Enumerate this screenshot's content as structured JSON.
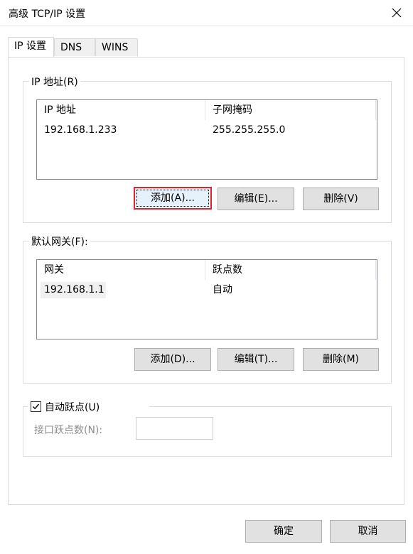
{
  "window": {
    "title": "高级 TCP/IP 设置"
  },
  "tabs": [
    {
      "label": "IP 设置",
      "active": true
    },
    {
      "label": "DNS",
      "active": false
    },
    {
      "label": "WINS",
      "active": false
    }
  ],
  "ip_section": {
    "legend": "IP 地址(R)",
    "columns": [
      "IP 地址",
      "子网掩码"
    ],
    "rows": [
      {
        "ip": "192.168.1.233",
        "mask": "255.255.255.0"
      }
    ],
    "buttons": {
      "add": "添加(A)...",
      "edit": "编辑(E)...",
      "delete": "删除(V)"
    }
  },
  "gateway_section": {
    "legend": "默认网关(F):",
    "columns": [
      "网关",
      "跃点数"
    ],
    "rows": [
      {
        "gateway": "192.168.1.1",
        "metric": "自动"
      }
    ],
    "buttons": {
      "add": "添加(D)...",
      "edit": "编辑(T)...",
      "delete": "删除(M)"
    }
  },
  "auto_metric": {
    "label": "自动跃点(U)",
    "checked": true,
    "interface_metric_label": "接口跃点数(N):",
    "interface_metric_value": ""
  },
  "footer": {
    "ok": "确定",
    "cancel": "取消"
  },
  "colors": {
    "focus_highlight": "#d9272f",
    "button_face": "#e1e1e1"
  }
}
